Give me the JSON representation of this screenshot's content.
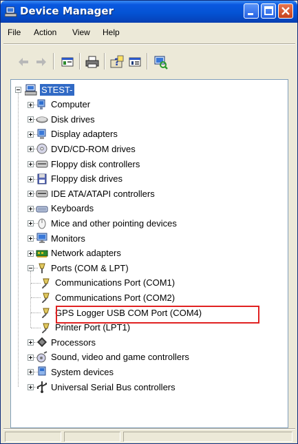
{
  "window": {
    "title": "Device Manager"
  },
  "menu": [
    "File",
    "Action",
    "View",
    "Help"
  ],
  "toolbar": [
    "back",
    "forward",
    "properties",
    "print",
    "help",
    "view",
    "scan"
  ],
  "tree": {
    "root": "STEST-",
    "categories": [
      {
        "label": "Computer",
        "icon": "computer-icon"
      },
      {
        "label": "Disk drives",
        "icon": "disk-drive-icon"
      },
      {
        "label": "Display adapters",
        "icon": "display-adapter-icon"
      },
      {
        "label": "DVD/CD-ROM drives",
        "icon": "cdrom-icon"
      },
      {
        "label": "Floppy disk controllers",
        "icon": "floppy-controller-icon"
      },
      {
        "label": "Floppy disk drives",
        "icon": "floppy-drive-icon"
      },
      {
        "label": "IDE ATA/ATAPI controllers",
        "icon": "ide-controller-icon"
      },
      {
        "label": "Keyboards",
        "icon": "keyboard-icon"
      },
      {
        "label": "Mice and other pointing devices",
        "icon": "mouse-icon"
      },
      {
        "label": "Monitors",
        "icon": "monitor-icon"
      },
      {
        "label": "Network adapters",
        "icon": "network-adapter-icon"
      },
      {
        "label": "Ports (COM & LPT)",
        "icon": "port-icon",
        "expanded": true,
        "children": [
          {
            "label": "Communications Port (COM1)"
          },
          {
            "label": "Communications Port (COM2)"
          },
          {
            "label": "GPS Logger USB COM Port (COM4)",
            "highlighted": true
          },
          {
            "label": "Printer Port (LPT1)"
          }
        ]
      },
      {
        "label": "Processors",
        "icon": "processor-icon"
      },
      {
        "label": "Sound, video and game controllers",
        "icon": "sound-icon"
      },
      {
        "label": "System devices",
        "icon": "system-device-icon"
      },
      {
        "label": "Universal Serial Bus controllers",
        "icon": "usb-icon"
      }
    ]
  },
  "colors": {
    "title_bar": "#0453d4",
    "selection": "#316ac5",
    "highlight_box": "#e02020"
  }
}
